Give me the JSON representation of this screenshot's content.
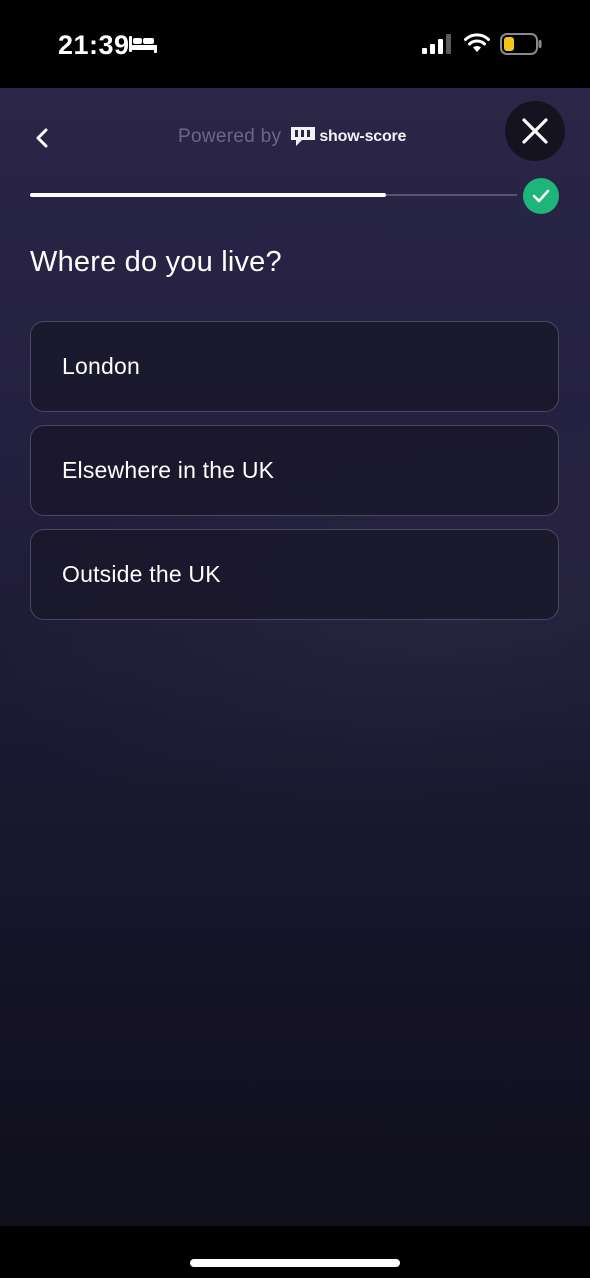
{
  "status_bar": {
    "time": "21:39",
    "icons": [
      "bed-icon",
      "cellular-signal-icon",
      "wifi-icon",
      "battery-icon"
    ],
    "battery_color": "#f5c518"
  },
  "header": {
    "back_icon": "chevron-left-icon",
    "powered_by_label": "Powered by",
    "brand_name": "show-score",
    "close_icon": "close-icon"
  },
  "progress": {
    "value_fraction": 0.73,
    "complete_icon": "checkmark-icon",
    "accent_color": "#1eb57a"
  },
  "question": {
    "text": "Where do you live?"
  },
  "options": [
    {
      "label": "London"
    },
    {
      "label": "Elsewhere in the UK"
    },
    {
      "label": "Outside the UK"
    }
  ]
}
